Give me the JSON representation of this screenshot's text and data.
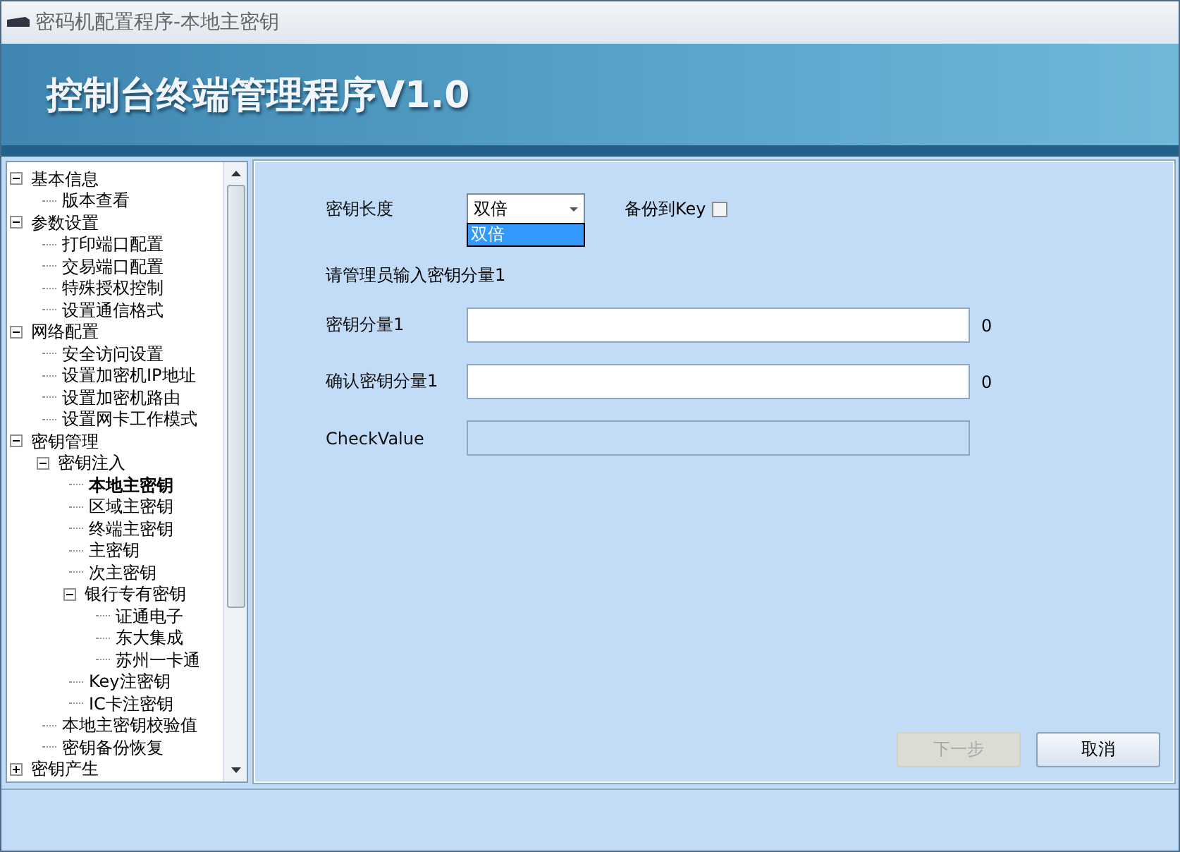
{
  "window": {
    "title": "密码机配置程序-本地主密钥"
  },
  "banner": {
    "title": "控制台终端管理程序V1.0"
  },
  "tree": [
    {
      "label": "基本信息",
      "expanded": true,
      "selected": false,
      "children": [
        {
          "label": "版本查看",
          "selected": false
        }
      ]
    },
    {
      "label": "参数设置",
      "expanded": true,
      "selected": false,
      "children": [
        {
          "label": "打印端口配置",
          "selected": false
        },
        {
          "label": "交易端口配置",
          "selected": false
        },
        {
          "label": "特殊授权控制",
          "selected": false
        },
        {
          "label": "设置通信格式",
          "selected": false
        }
      ]
    },
    {
      "label": "网络配置",
      "expanded": true,
      "selected": false,
      "children": [
        {
          "label": "安全访问设置",
          "selected": false
        },
        {
          "label": "设置加密机IP地址",
          "selected": false
        },
        {
          "label": "设置加密机路由",
          "selected": false
        },
        {
          "label": "设置网卡工作模式",
          "selected": false
        }
      ]
    },
    {
      "label": "密钥管理",
      "expanded": true,
      "selected": false,
      "children": [
        {
          "label": "密钥注入",
          "expanded": true,
          "selected": false,
          "children": [
            {
              "label": "本地主密钥",
              "selected": true
            },
            {
              "label": "区域主密钥",
              "selected": false
            },
            {
              "label": "终端主密钥",
              "selected": false
            },
            {
              "label": "主密钥",
              "selected": false
            },
            {
              "label": "次主密钥",
              "selected": false
            },
            {
              "label": "银行专有密钥",
              "expanded": true,
              "selected": false,
              "children": [
                {
                  "label": "证通电子",
                  "selected": false
                },
                {
                  "label": "东大集成",
                  "selected": false
                },
                {
                  "label": "苏州一卡通",
                  "selected": false
                }
              ]
            },
            {
              "label": "Key注密钥",
              "selected": false
            },
            {
              "label": "IC卡注密钥",
              "selected": false
            }
          ]
        },
        {
          "label": "本地主密钥校验值",
          "selected": false
        },
        {
          "label": "密钥备份恢复",
          "selected": false
        }
      ]
    },
    {
      "label": "密钥产生",
      "expanded": false,
      "selected": false
    }
  ],
  "form": {
    "key_length_label": "密钥长度",
    "key_length_value": "双倍",
    "dropdown_options": [
      {
        "label": "双倍",
        "selected": true
      }
    ],
    "backup_label": "备份到Key",
    "backup_checked": false,
    "prompt": "请管理员输入密钥分量1",
    "fields": [
      {
        "label": "密钥分量1",
        "count": "0",
        "disabled": false
      },
      {
        "label": "确认密钥分量1",
        "count": "0",
        "disabled": false
      },
      {
        "label": "CheckValue",
        "disabled": true
      }
    ]
  },
  "buttons": [
    {
      "label": "下一步",
      "disabled": true
    },
    {
      "label": "取消",
      "disabled": false
    }
  ]
}
